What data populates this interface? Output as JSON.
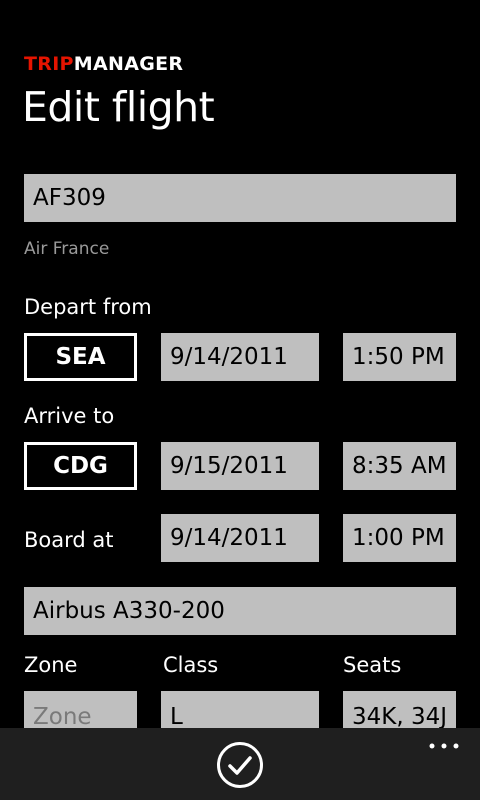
{
  "header": {
    "brand_part1": "TRIP",
    "brand_part2": "MANAGER",
    "page_title": "Edit flight"
  },
  "flight": {
    "number": "AF309",
    "airline": "Air France"
  },
  "depart": {
    "label": "Depart from",
    "airport": "SEA",
    "date": "9/14/2011",
    "time": "1:50 PM"
  },
  "arrive": {
    "label": "Arrive to",
    "airport": "CDG",
    "date": "9/15/2011",
    "time": "8:35 AM"
  },
  "board": {
    "label": "Board at",
    "date": "9/14/2011",
    "time": "1:00 PM"
  },
  "aircraft": "Airbus A330-200",
  "seating": {
    "zone_label": "Zone",
    "zone_placeholder": "Zone",
    "class_label": "Class",
    "class_value": "L",
    "seats_label": "Seats",
    "seats_value": "34K, 34J"
  },
  "app_bar": {
    "save_icon": "check-icon",
    "more_icon": "ellipsis-icon"
  },
  "colors": {
    "brand_accent": "#e51400",
    "background": "#000000",
    "field_background": "#bfbfbf",
    "app_bar_background": "#1f1f1f"
  }
}
